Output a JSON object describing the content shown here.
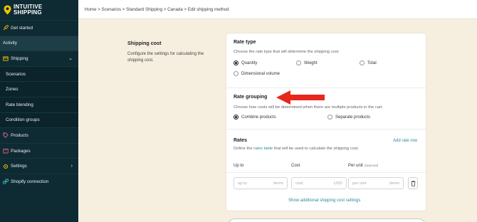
{
  "brand": {
    "line1": "INTUITIVE",
    "line2": "SHIPPING"
  },
  "sidebar": {
    "items": [
      {
        "label": "Get started",
        "icon": "rocket-icon"
      },
      {
        "label": "Activity"
      },
      {
        "label": "Shipping",
        "icon": "box-icon"
      },
      {
        "label": "Scenarios"
      },
      {
        "label": "Zones"
      },
      {
        "label": "Rate blending"
      },
      {
        "label": "Condition groups"
      },
      {
        "label": "Products",
        "icon": "tag-icon"
      },
      {
        "label": "Packages",
        "icon": "package-icon"
      },
      {
        "label": "Settings",
        "icon": "gear-icon"
      },
      {
        "label": "Shopify connection",
        "icon": "link-icon"
      }
    ]
  },
  "breadcrumb": "Home > Scenarios > Standard Shipping > Canada > Edit shipping method",
  "section": {
    "title": "Shipping cost",
    "description": "Configure the settings for calculating the shipping cost."
  },
  "rate_type": {
    "title": "Rate type",
    "subtitle": "Choose the rate type that will determine the shipping cost.",
    "options": [
      "Quantity",
      "Weight",
      "Total",
      "Dimensional volume"
    ],
    "selected": "Quantity"
  },
  "rate_grouping": {
    "title": "Rate grouping",
    "subtitle": "Choose how costs will be determined when there are multiple products in the cart.",
    "options": [
      "Combine products",
      "Separate products"
    ],
    "selected": "Combine products"
  },
  "rates": {
    "title": "Rates",
    "add_label": "Add rate row",
    "desc_before": "Define the ",
    "desc_link": "rates table",
    "desc_after": " that will be used to calculate the shipping cost.",
    "col_up_to": "Up to",
    "col_cost": "Cost",
    "col_per_unit": "Per unit",
    "col_per_unit_note": "(Optional)",
    "row": {
      "up_to_placeholder": "up to",
      "up_to_unit": "items",
      "cost_placeholder": "cost",
      "cost_unit": "USD",
      "per_unit_placeholder": "per unit",
      "per_unit_unit": "items"
    },
    "additional_link": "Show additional shipping cost settings"
  },
  "colors": {
    "sidebar": "#0e2a33",
    "accent": "#2e8a9a",
    "brand": "#f5c400",
    "arrow": "#e8271c",
    "page_bg": "#f6efe0"
  }
}
